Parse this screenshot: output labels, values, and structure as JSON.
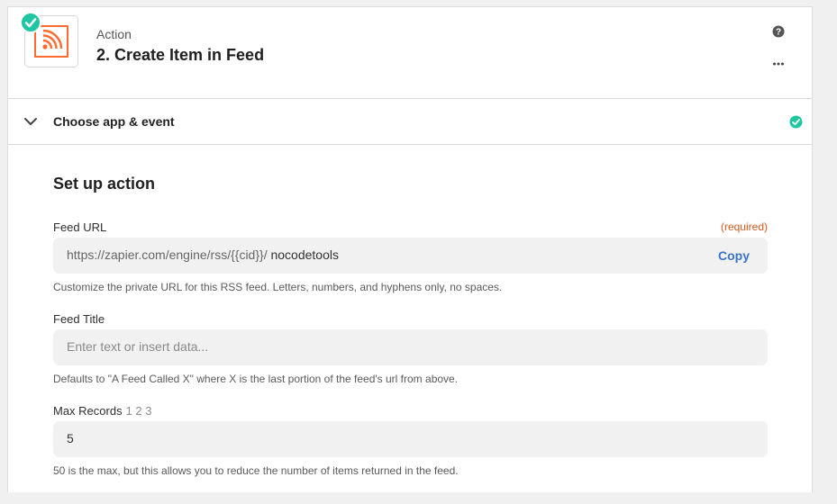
{
  "step": {
    "kicker": "Action",
    "title": "2. Create Item in Feed",
    "app_icon": "rss-icon",
    "status": "complete"
  },
  "header_icons": {
    "help": "question-circle-icon",
    "more": "more-horizontal-icon"
  },
  "section": {
    "label": "Choose app & event",
    "expand_icon": "chevron-down-icon",
    "status_icon": "check-circle-icon"
  },
  "setup": {
    "title": "Set up action",
    "fields": {
      "feed_url": {
        "label": "Feed URL",
        "required": "(required)",
        "prefix": "https://zapier.com/engine/rss/{{cid}}/",
        "value": "nocodetools",
        "copy_label": "Copy",
        "help": "Customize the private URL for this RSS feed. Letters, numbers, and hyphens only, no spaces."
      },
      "feed_title": {
        "label": "Feed Title",
        "placeholder": "Enter text or insert data...",
        "help": "Defaults to \"A Feed Called X\" where X is the last portion of the feed's url from above."
      },
      "max_records": {
        "label": "Max Records",
        "sub": "1 2 3",
        "value": "5",
        "help": "50 is the max, but this allows you to reduce the number of items returned in the feed."
      }
    }
  },
  "colors": {
    "accent_green": "#1ec6a1",
    "rss_orange": "#ff6b2f",
    "link_blue": "#3a73c9",
    "required_orange": "#d9591e"
  }
}
